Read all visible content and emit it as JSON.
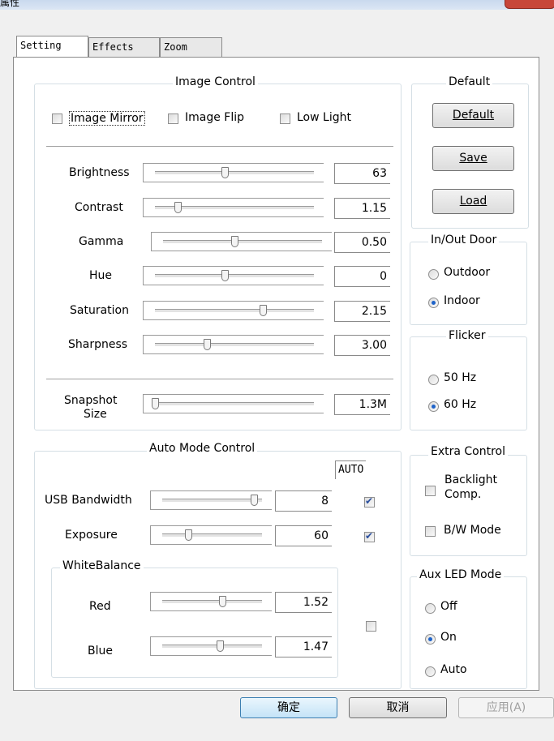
{
  "window": {
    "title": "属性"
  },
  "tabs": [
    {
      "label": "Setting"
    },
    {
      "label": "Effects"
    },
    {
      "label": "Zoom"
    }
  ],
  "image_control": {
    "title": "Image Control",
    "checkboxes": [
      {
        "label": "Image Mirror",
        "checked": false
      },
      {
        "label": "Image Flip",
        "checked": false
      },
      {
        "label": "Low Light",
        "checked": false
      }
    ],
    "sliders": [
      {
        "label": "Brightness",
        "value": "63",
        "pos": 0.46
      },
      {
        "label": "Contrast",
        "value": "1.15",
        "pos": 0.15
      },
      {
        "label": "Gamma",
        "value": "0.50",
        "pos": 0.47
      },
      {
        "label": "Hue",
        "value": "0",
        "pos": 0.46
      },
      {
        "label": "Saturation",
        "value": "2.15",
        "pos": 0.71
      },
      {
        "label": "Sharpness",
        "value": "3.00",
        "pos": 0.34
      }
    ],
    "snapshot": {
      "label1": "Snapshot",
      "label2": "Size",
      "value": "1.3M",
      "pos": 0.0
    }
  },
  "default_group": {
    "title": "Default",
    "default_btn": "Default",
    "save_btn": "Save",
    "load_btn": "Load"
  },
  "inout": {
    "title": "In/Out Door",
    "options": [
      {
        "label": "Outdoor",
        "checked": false
      },
      {
        "label": "Indoor",
        "checked": true
      }
    ]
  },
  "flicker": {
    "title": "Flicker",
    "options": [
      {
        "label": "50 Hz",
        "checked": false
      },
      {
        "label": "60 Hz",
        "checked": true
      }
    ]
  },
  "auto_mode": {
    "title": "Auto Mode Control",
    "auto_header": "AUTO",
    "sliders": [
      {
        "label": "USB Bandwidth",
        "value": "8",
        "pos": 0.98,
        "auto": true
      },
      {
        "label": "Exposure",
        "value": "60",
        "pos": 0.28,
        "auto": true
      }
    ],
    "whitebalance": {
      "title": "WhiteBalance",
      "auto": false,
      "sliders": [
        {
          "label": "Red",
          "value": "1.52",
          "pos": 0.64
        },
        {
          "label": "Blue",
          "value": "1.47",
          "pos": 0.62
        }
      ]
    }
  },
  "extra": {
    "title": "Extra Control",
    "backlight1": "Backlight",
    "backlight2": "Comp.",
    "bw": "B/W Mode"
  },
  "aux_led": {
    "title": "Aux LED Mode",
    "options": [
      {
        "label": "Off",
        "checked": false
      },
      {
        "label": "On",
        "checked": true
      },
      {
        "label": "Auto",
        "checked": false
      }
    ]
  },
  "buttons": {
    "ok": "确定",
    "cancel": "取消",
    "apply": "应用(A)"
  }
}
